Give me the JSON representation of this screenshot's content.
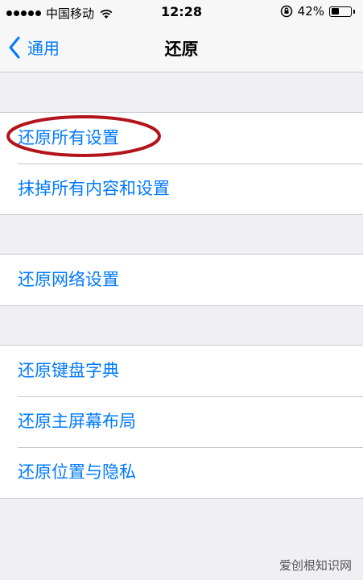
{
  "status_bar": {
    "carrier": "中国移动",
    "time": "12:28",
    "battery": "42%",
    "battery_level": 0.42
  },
  "nav": {
    "back_label": "通用",
    "title": "还原"
  },
  "groups": [
    {
      "items": [
        "还原所有设置",
        "抹掉所有内容和设置"
      ]
    },
    {
      "items": [
        "还原网络设置"
      ]
    },
    {
      "items": [
        "还原键盘字典",
        "还原主屏幕布局",
        "还原位置与隐私"
      ]
    }
  ],
  "annotation": {
    "color": "#b3141b",
    "target": "还原所有设置"
  },
  "watermark": "爱创根知识网",
  "colors": {
    "accent": "#007aff",
    "background": "#efeff4",
    "separator": "#c8c7cc"
  }
}
